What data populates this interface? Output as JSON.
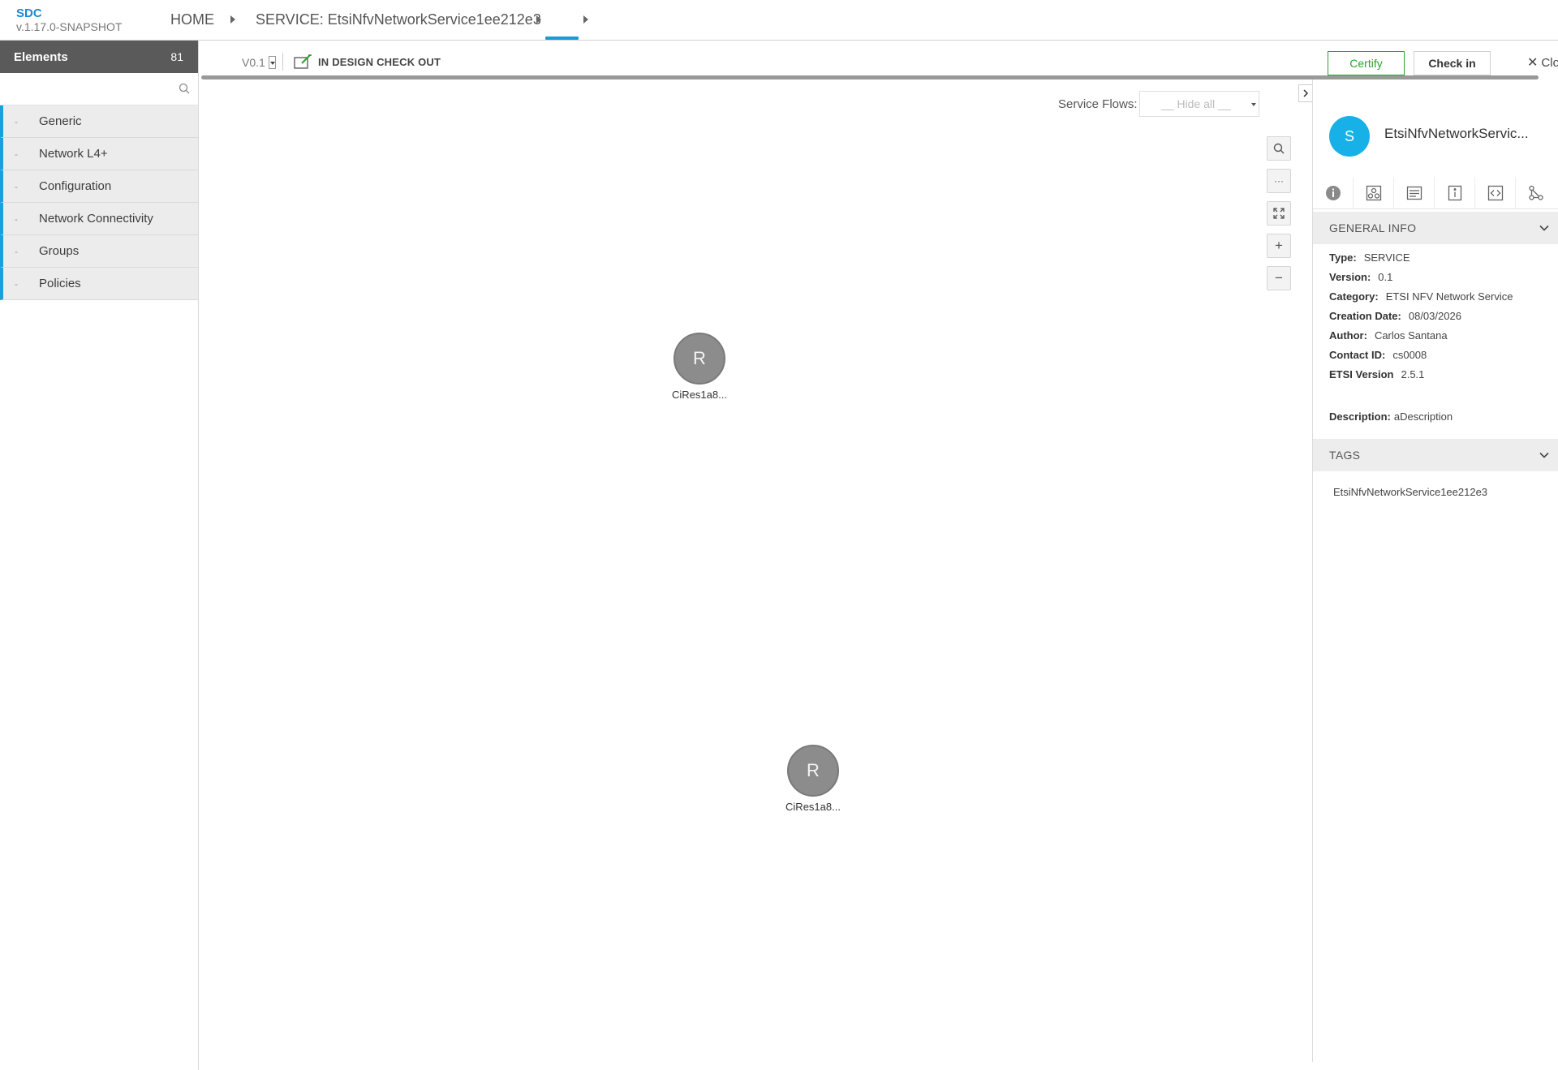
{
  "header": {
    "brand": "SDC",
    "version": "v.1.17.0-SNAPSHOT",
    "breadcrumbs": [
      "HOME",
      "SERVICE: EtsiNfvNetworkService1ee212e3",
      ""
    ]
  },
  "palette": {
    "title": "Elements",
    "count": "81",
    "search_placeholder": "",
    "categories": [
      "Generic",
      "Network L4+",
      "Configuration",
      "Network Connectivity",
      "Groups",
      "Policies"
    ],
    "category_marker": "-"
  },
  "toolbar": {
    "version": "V0.1",
    "status": "IN DESIGN CHECK OUT",
    "certify": "Certify",
    "checkin": "Check in",
    "close": "Clo"
  },
  "canvas": {
    "service_flows_label": "Service Flows:",
    "service_flows_value": "__ Hide all __",
    "nodes": [
      {
        "letter": "R",
        "name": "CiRes1a8..."
      },
      {
        "letter": "R",
        "name": "CiRes1a8..."
      }
    ]
  },
  "details": {
    "avatar_letter": "S",
    "title": "EtsiNfvNetworkServic...",
    "general_info_title": "GENERAL INFO",
    "fields": [
      {
        "label": "Type:",
        "value": "SERVICE"
      },
      {
        "label": "Version:",
        "value": "0.1"
      },
      {
        "label": "Category:",
        "value": "ETSI NFV Network Service"
      },
      {
        "label": "Creation Date:",
        "value": "08/03/2026"
      },
      {
        "label": "Author:",
        "value": "Carlos Santana"
      },
      {
        "label": "Contact ID:",
        "value": "cs0008"
      },
      {
        "label": "ETSI Version",
        "value": "2.5.1"
      }
    ],
    "description_label": "Description:",
    "description_value": "aDescription",
    "tags_title": "TAGS",
    "tags": [
      "EtsiNfvNetworkService1ee212e3"
    ]
  },
  "colors": {
    "accent": "#1a9ad6",
    "palette_header": "#5a5a5a",
    "certify": "#2aa52a",
    "avatar": "#17b1e8",
    "node": "#8c8c8c"
  }
}
